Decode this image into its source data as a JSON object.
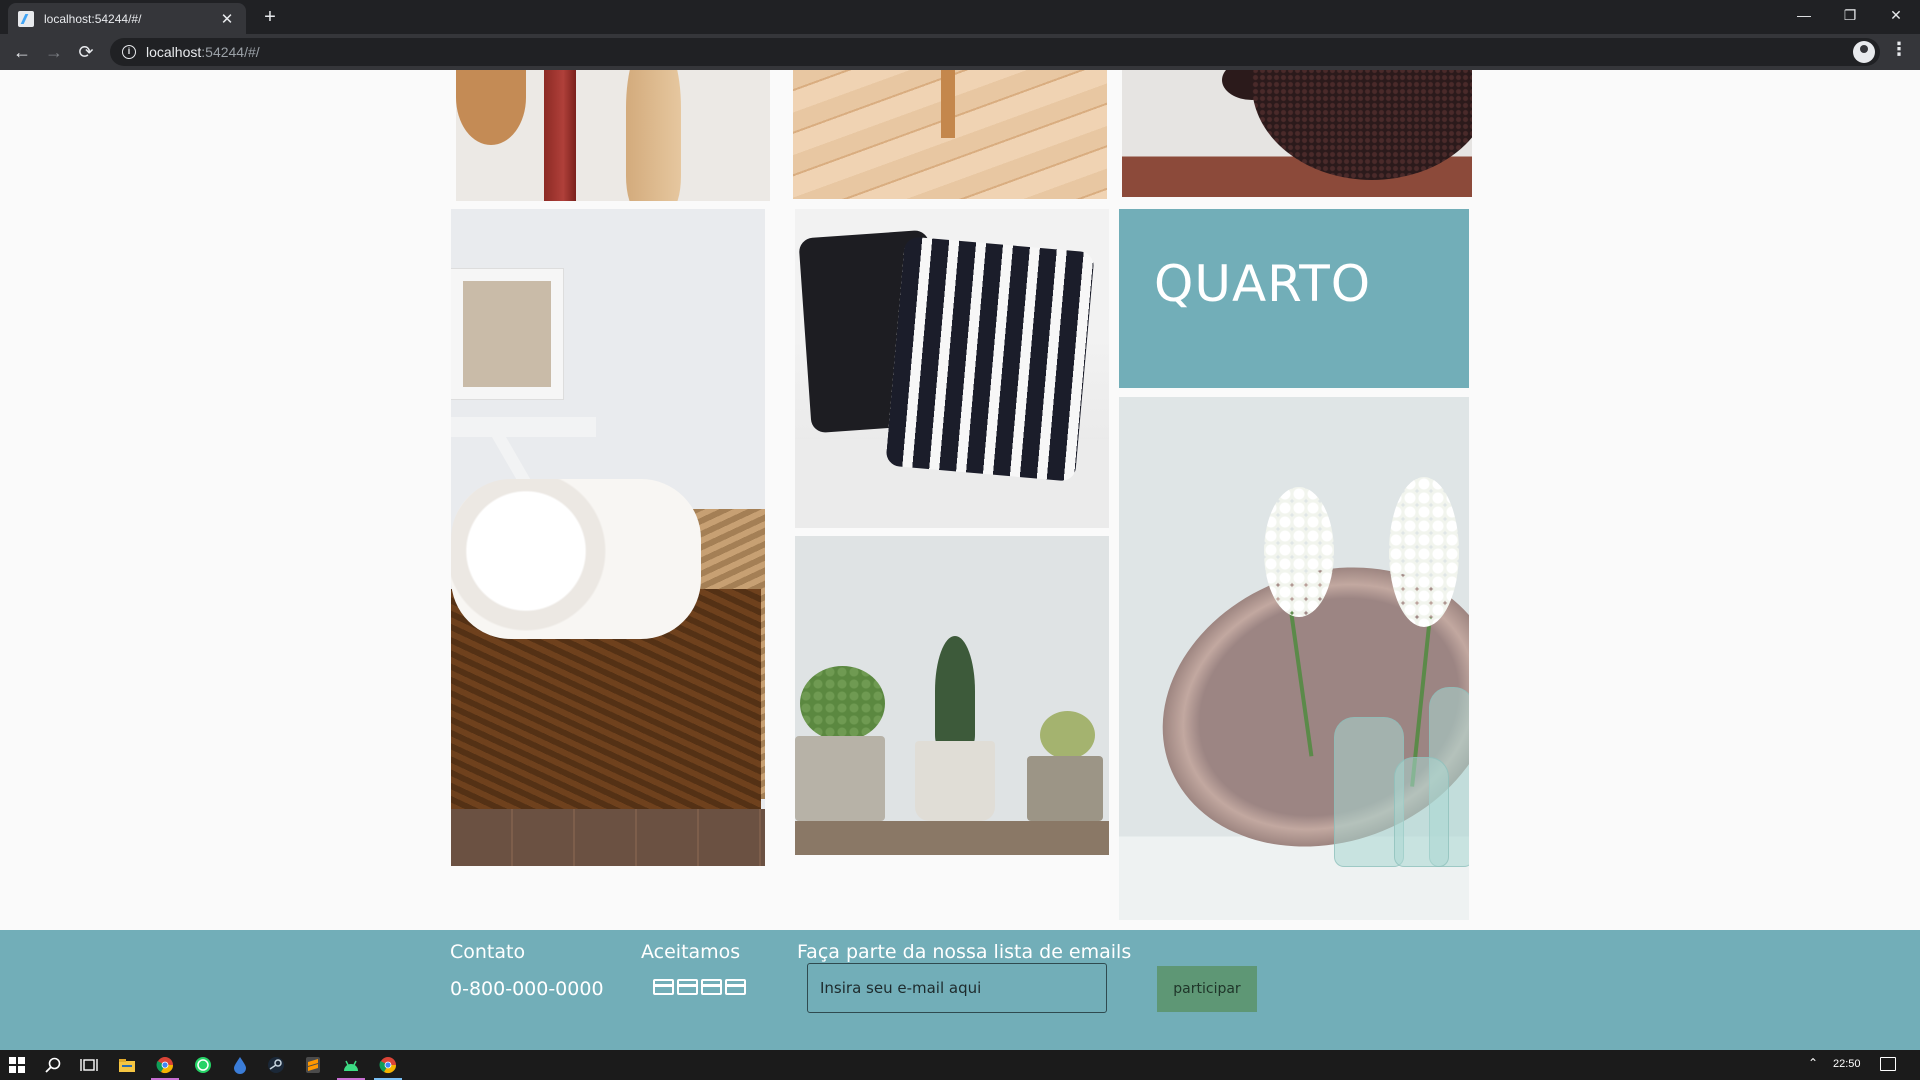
{
  "browser": {
    "tab_title": "localhost:54244/#/",
    "tab_close": "✕",
    "new_tab": "+",
    "url_host": "localhost",
    "url_path": ":54244/#/",
    "back": "←",
    "forward": "→",
    "reload": "⟳",
    "star": "☆",
    "menu": "⋮",
    "minimize": "—",
    "restore": "❐",
    "close": "✕"
  },
  "gallery": {
    "title": "QUARTO"
  },
  "footer": {
    "contact_heading": "Contato",
    "contact_phone": "0-800-000-0000",
    "payment_heading": "Aceitamos",
    "newsletter_heading": "Faça parte da nossa lista de emails",
    "email_placeholder": "Insira seu e-mail aqui",
    "join_label": "participar"
  },
  "taskbar": {
    "time": "22:50",
    "chevron": "⌃"
  },
  "colors": {
    "accent": "#72aeb8",
    "button": "#5e9775",
    "chrome_dark": "#202124",
    "chrome_toolbar": "#35363a"
  },
  "icons": [
    "info-icon",
    "star-icon",
    "profile-icon",
    "menu-icon",
    "credit-card-icon",
    "windows-start-icon",
    "search-icon",
    "task-view-icon",
    "file-explorer-icon",
    "chrome-icon",
    "whatsapp-icon",
    "steam-icon",
    "sublime-icon",
    "android-studio-icon",
    "notification-icon"
  ]
}
